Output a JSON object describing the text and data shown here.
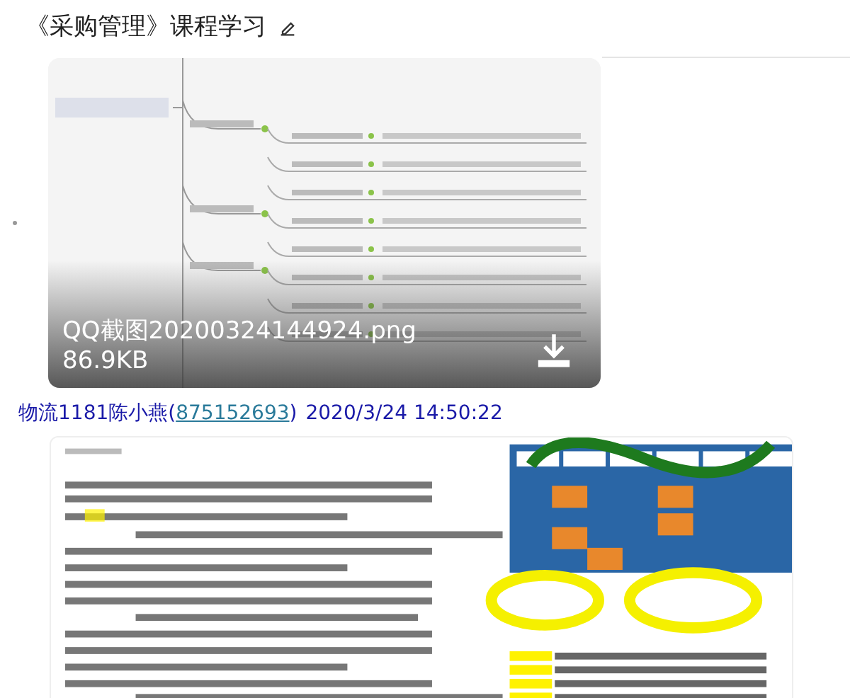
{
  "page": {
    "title": "《采购管理》课程学习"
  },
  "attachment": {
    "file_name": "QQ截图20200324144924.png",
    "file_size": "86.9KB"
  },
  "message": {
    "author": "物流1181陈小燕(",
    "qq": "875152693",
    "author_end": ")",
    "time": "2020/3/24 14:50:22"
  }
}
